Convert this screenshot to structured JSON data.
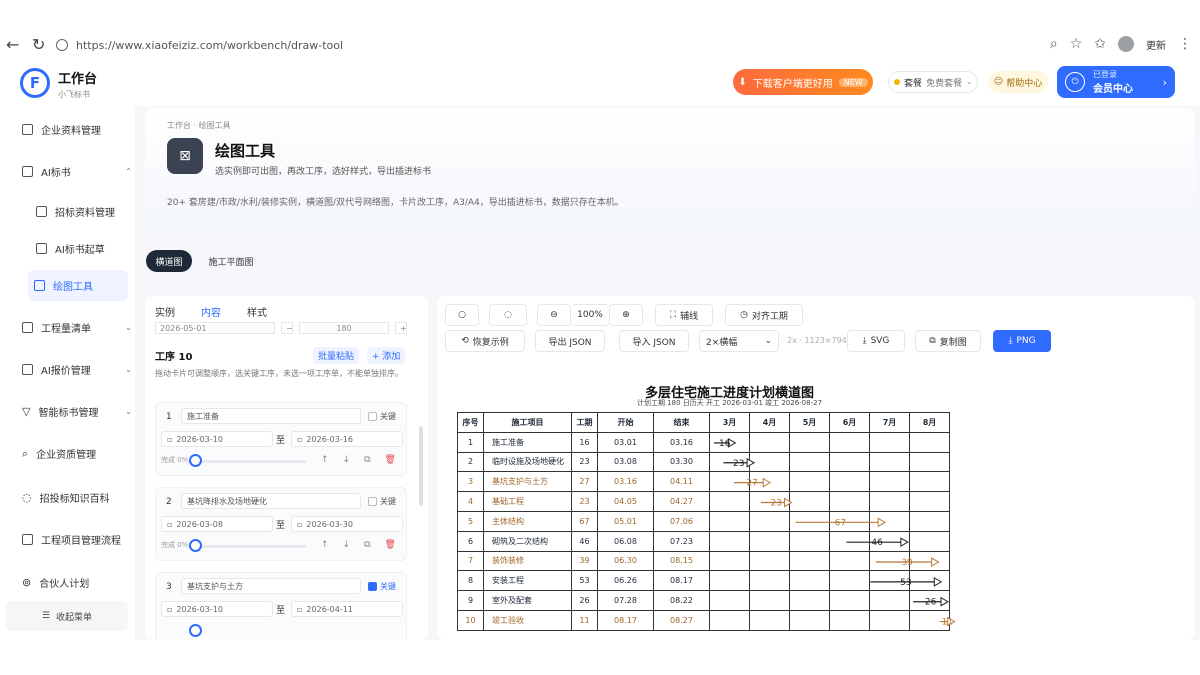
{
  "browser": {
    "url": "https://www.xiaofeiziz.com/workbench/draw-tool",
    "profile_label": "更新"
  },
  "topbar": {
    "brand_title": "工作台",
    "brand_subtitle": "小飞标书",
    "download_label": "下载客户端更好用",
    "download_tag": "NEW",
    "plan_label": "套餐",
    "plan_value": "免费套餐",
    "help_label": "帮助中心",
    "user_line1": "已登录",
    "user_line2": "会员中心"
  },
  "sidebar": {
    "items": [
      {
        "label": "企业资料管理"
      },
      {
        "label": "AI标书"
      },
      {
        "label": "招标资料管理"
      },
      {
        "label": "AI标书起草"
      },
      {
        "label": "绘图工具"
      },
      {
        "label": "工程量清单"
      },
      {
        "label": "AI报价管理"
      },
      {
        "label": "智能标书管理"
      },
      {
        "label": "企业资质管理"
      },
      {
        "label": "招投标知识百科"
      },
      {
        "label": "工程项目管理流程"
      },
      {
        "label": "合伙人计划"
      }
    ],
    "collapse_label": "收起菜单"
  },
  "header": {
    "breadcrumb": "工作台 · 绘图工具",
    "title": "绘图工具",
    "subtitle": "选实例即可出图，再改工序，选好样式，导出插进标书",
    "description": "20+ 套房建/市政/水利/装修实例，横道图/双代号网络图，卡片改工序，A3/A4，导出插进标书，数据只存在本机。"
  },
  "tabs": {
    "active": "横道图",
    "inactive": "施工平面图"
  },
  "left_panel": {
    "tabs": [
      "实例",
      "内容",
      "样式"
    ],
    "active_tab": "内容",
    "top_row_date": "2026-05-01",
    "top_row_value": "180",
    "section_title": "工序 10",
    "batch_label": "批量粘贴",
    "add_label": "+ 添加",
    "hint": "拖动卡片可调整顺序，选关键工序，未选一项工序单，不能单独排序。",
    "key_label": "关键",
    "to_label": "至",
    "progress_label": "完成 0%",
    "tasks": [
      {
        "num": "1",
        "name": "施工准备",
        "start": "2026-03-10",
        "end": "2026-03-16",
        "key": false
      },
      {
        "num": "2",
        "name": "基坑降排水及场地硬化",
        "start": "2026-03-08",
        "end": "2026-03-30",
        "key": false
      },
      {
        "num": "3",
        "name": "基坑支护与土方",
        "start": "2026-03-10",
        "end": "2026-04-11",
        "key": true
      }
    ]
  },
  "toolbar": {
    "zoom_out": "○",
    "zoom_fit": "◌",
    "zoom_value": "100%",
    "snap_label": "辅线",
    "align_label": "对齐工期",
    "restore_label": "恢复示例",
    "export_json_label": "导出 JSON",
    "import_json_label": "导入 JSON",
    "paper_select": "2×横幅",
    "size_text": "2x · 1123×794",
    "svg_label": "SVG",
    "copy_label": "复制图",
    "png_label": "PNG"
  },
  "chart_data": {
    "type": "table",
    "title": "多层住宅施工进度计划横道图",
    "subtitle": "计划工期 180 日历天 开工 2026-03-01 竣工 2026-08-27",
    "columns": [
      "序号",
      "施工项目",
      "工期",
      "开始",
      "结束",
      "3月",
      "4月",
      "5月",
      "6月",
      "7月",
      "8月"
    ],
    "months": [
      "3月",
      "4月",
      "5月",
      "6月",
      "7月",
      "8月"
    ],
    "rows": [
      {
        "no": "1",
        "name": "施工准备",
        "days": "16",
        "start": "03.01",
        "end": "03.16",
        "critical": false
      },
      {
        "no": "2",
        "name": "临时设施及场地硬化",
        "days": "23",
        "start": "03.08",
        "end": "03.30",
        "critical": false
      },
      {
        "no": "3",
        "name": "基坑支护与土方",
        "days": "27",
        "start": "03.16",
        "end": "04.11",
        "critical": true
      },
      {
        "no": "4",
        "name": "基础工程",
        "days": "23",
        "start": "04.05",
        "end": "04.27",
        "critical": true
      },
      {
        "no": "5",
        "name": "主体结构",
        "days": "67",
        "start": "05.01",
        "end": "07.06",
        "critical": true
      },
      {
        "no": "6",
        "name": "砌筑及二次结构",
        "days": "46",
        "start": "06.08",
        "end": "07.23",
        "critical": false
      },
      {
        "no": "7",
        "name": "装饰装修",
        "days": "39",
        "start": "06.30",
        "end": "08.15",
        "critical": true
      },
      {
        "no": "8",
        "name": "安装工程",
        "days": "53",
        "start": "06.26",
        "end": "08.17",
        "critical": false
      },
      {
        "no": "9",
        "name": "室外及配套",
        "days": "26",
        "start": "07.28",
        "end": "08.22",
        "critical": false
      },
      {
        "no": "10",
        "name": "竣工验收",
        "days": "11",
        "start": "08.17",
        "end": "08.27",
        "critical": true
      }
    ],
    "colors": {
      "normal": "#222222",
      "critical": "#b7793a"
    }
  }
}
